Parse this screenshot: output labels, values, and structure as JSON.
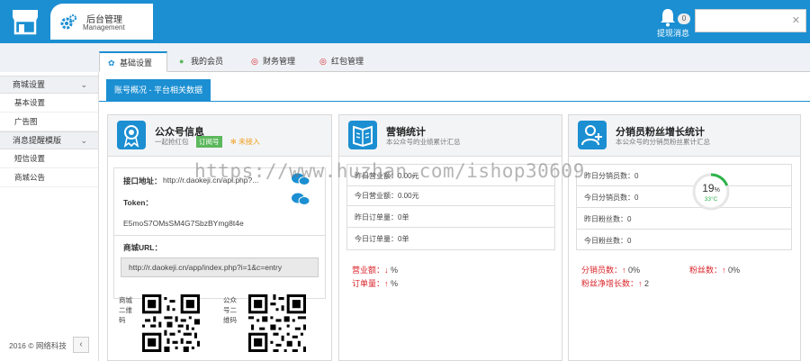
{
  "header": {
    "brand_title": "后台管理",
    "brand_subtitle": "Management",
    "notify_count": "0",
    "notify_label": "提现消息",
    "close_glyph": "✕"
  },
  "sidebar": {
    "groups": [
      {
        "label": "商城设置",
        "items": [
          "基本设置",
          "广告图"
        ]
      },
      {
        "label": "消息提醒模版",
        "items": [
          "短信设置",
          "商城公告"
        ]
      }
    ],
    "footer": "2016 © 网络科技",
    "collapse_glyph": "‹"
  },
  "tabs": [
    {
      "label": "基础设置",
      "icon": "gear-icon"
    },
    {
      "label": "我的会员",
      "icon": "user-icon"
    },
    {
      "label": "财务管理",
      "icon": "money-icon"
    },
    {
      "label": "红包管理",
      "icon": "redpacket-icon"
    }
  ],
  "subtab": "账号概况 - 平台相关数据",
  "panel1": {
    "title": "公众号信息",
    "subtitle": "一起抢红包",
    "tag": "订阅号",
    "status": "未接入",
    "api_label": "接口地址：",
    "api_value": "http://r.daokeji.cn/api.php?...",
    "token_label": "Token：",
    "token_value": "E5moS7OMsSM4G7SbzBYmg8t4e",
    "mall_url_label": "商城URL：",
    "mall_url_value": "http://r.daokeji.cn/app/index.php?i=1&c=entry",
    "qr1_label": "商城二维码",
    "qr2_label": "公众号二维码"
  },
  "panel2": {
    "title": "营销统计",
    "subtitle": "本公众号的业绩累计汇总",
    "rows": [
      {
        "label": "昨日营业额：",
        "value": "0.00元"
      },
      {
        "label": "今日营业额：",
        "value": "0.00元"
      },
      {
        "label": "昨日订单量：",
        "value": "0单"
      },
      {
        "label": "今日订单量：",
        "value": "0单"
      }
    ],
    "stat1_label": "营业额：",
    "stat1_arrow": "↓",
    "stat1_value": "%",
    "stat2_label": "订单量：",
    "stat2_arrow": "↑",
    "stat2_value": "%"
  },
  "panel3": {
    "title": "分销员粉丝增长统计",
    "subtitle": "本公众号的分销员粉丝累计汇总",
    "rows": [
      {
        "label": "昨日分销员数：",
        "value": "0"
      },
      {
        "label": "今日分销员数：",
        "value": "0"
      },
      {
        "label": "昨日粉丝数：",
        "value": "0"
      },
      {
        "label": "今日粉丝数：",
        "value": "0"
      }
    ],
    "stat1_label": "分销员数：",
    "stat1_arrow": "↑",
    "stat1_value": "0%",
    "stat2_label": "粉丝数：",
    "stat2_arrow": "↑",
    "stat2_value": "0%",
    "stat3_label": "粉丝净增长数：",
    "stat3_arrow": "↑",
    "stat3_value": "2"
  },
  "gauge": {
    "percent": "19",
    "unit": "%",
    "temp": "33°C",
    "fraction": 0.19
  },
  "watermark": "https://www.huzhan.com/ishop30609",
  "colors": {
    "primary": "#1b8fd2",
    "danger": "#d9262c",
    "success": "#5cb85c",
    "warning": "#f0a020"
  }
}
